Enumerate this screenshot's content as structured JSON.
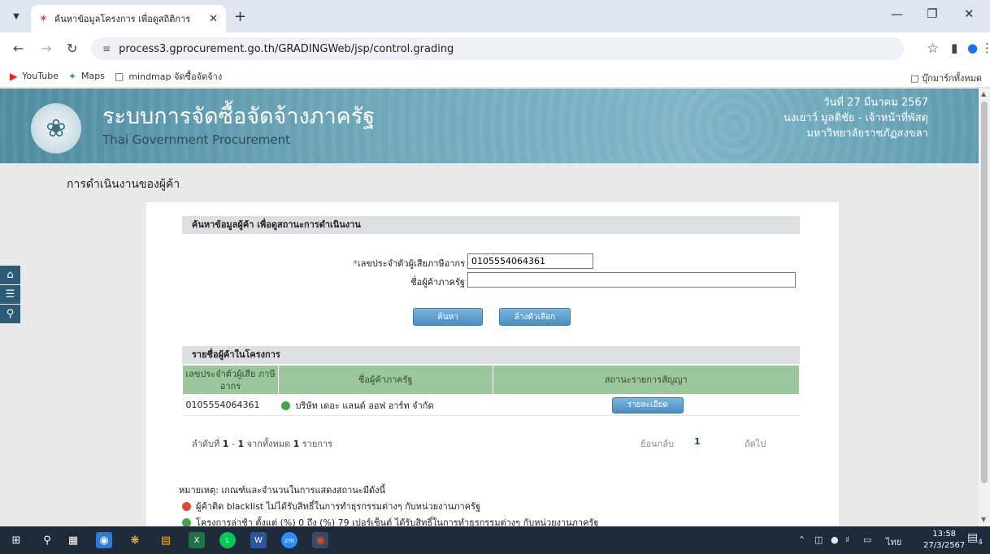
{
  "browser": {
    "tab_title": "ค้นหาข้อมูลโครงการ เพื่อดูสถิติการ",
    "new_tab": "+",
    "url": "process3.gprocurement.go.th/GRADINGWeb/jsp/control.grading",
    "bookmarks": [
      {
        "label": "YouTube",
        "icon": "youtube-icon"
      },
      {
        "label": "Maps",
        "icon": "maps-icon"
      },
      {
        "label": "mindmap จัดซื้อจัดจ้าง",
        "icon": "folder-icon"
      }
    ],
    "all_bookmarks": "บุ๊กมาร์กทั้งหมด"
  },
  "header": {
    "title": "ระบบการจัดซื้อจัดจ้างภาครัฐ",
    "subtitle": "Thai Government Procurement",
    "date": "วันที่ 27 มีนาคม 2567",
    "user": "นงเยาว์ มูลติชัย - เจ้าหน้าที่พัสดุ",
    "org": "มหาวิทยาลัยราชภัฏสงขลา"
  },
  "page": {
    "heading": "การดำเนินงานของผู้ค้า"
  },
  "search": {
    "section_title": "ค้นหาข้อมูลผู้ค้า เพื่อดูสถานะการดำเนินงาน",
    "required_mark": "*",
    "tax_id_label": "เลขประจำตัวผู้เสียภาษีอากร",
    "tax_id_value": "0105554064361",
    "vendor_name_label": "ชื่อผู้ค้าภาครัฐ",
    "vendor_name_value": "",
    "search_button": "ค้นหา",
    "clear_button": "ล้างตัวเลือก"
  },
  "results": {
    "section_title": "รายชื่อผู้ค้าในโครงการ",
    "columns": [
      "เลขประจำตัวผู้เสีย ภาษีอากร",
      "ชื่อผู้ค้าภาครัฐ",
      "สถานะรายการสัญญา"
    ],
    "rows": [
      {
        "tax_id": "0105554064361",
        "name": "บริษัท เดอะ แลนด์ ออฟ อาร์ท จำกัด",
        "status_color": "#4aa24a",
        "action": "รายละเอียด"
      }
    ],
    "pager": {
      "prefix": "ลำดับที่",
      "from": "1",
      "dash": "-",
      "to": "1",
      "of_label": "จากทั้งหมด",
      "total": "1",
      "unit": "รายการ",
      "back": "ย้อนกลับ",
      "current": "1",
      "next": "ถัดไป"
    }
  },
  "remark": {
    "title": "หมายเหตุ: เกณฑ์และจำนวนในการแสดงสถานะมีดังนี้",
    "items": [
      {
        "color": "#d94a3a",
        "text": "ผู้ค้าติด blacklist ไม่ได้รับสิทธิ์ในการทำธุรกรรมต่างๆ กับหน่วยงานภาครัฐ"
      },
      {
        "color": "#4aa24a",
        "text": "โครงการล่าช้า ตั้งแต่ (%) 0 ถึง (%) 79 เปอร์เซ็นต์ ได้รับสิทธิ์ในการทำธุรกรรมต่างๆ กับหน่วยงานภาครัฐ"
      }
    ]
  },
  "taskbar": {
    "lang": "ไทย",
    "time": "13:58",
    "date": "27/3/2567",
    "notifications": "4"
  }
}
